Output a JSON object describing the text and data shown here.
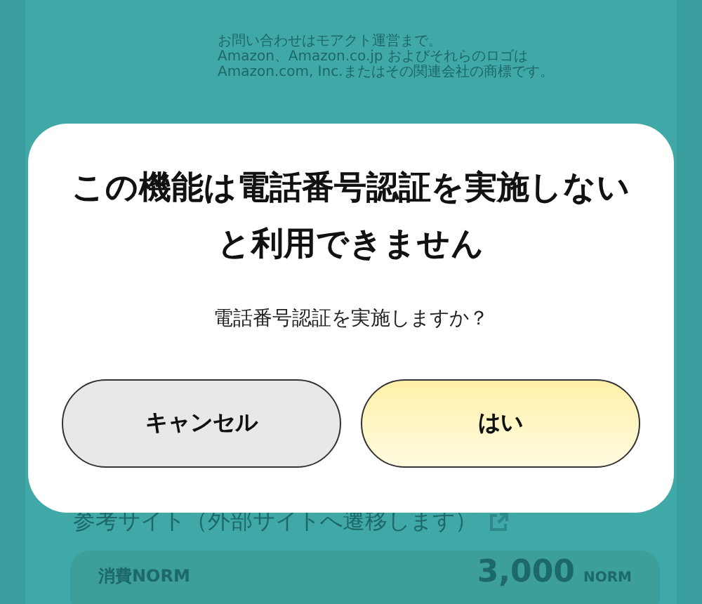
{
  "background": {
    "contact_lines": [
      "お問い合わせはモアクト運営まで。",
      "Amazon、Amazon.co.jp およびそれらのロゴは",
      "Amazon.com, Inc.またはその関連会社の商標です。"
    ],
    "reference_link": "参考サイト（外部サイトへ遷移します）",
    "cost_card": {
      "label": "消費NORM",
      "amount": "3,000",
      "unit": "NORM"
    }
  },
  "dialog": {
    "title": "この機能は電話番号認証を実施しないと利用できません",
    "message": "電話番号認証を実施しますか？",
    "buttons": [
      {
        "label": "キャンセル",
        "kind": "secondary"
      },
      {
        "label": "はい",
        "kind": "primary"
      }
    ]
  }
}
